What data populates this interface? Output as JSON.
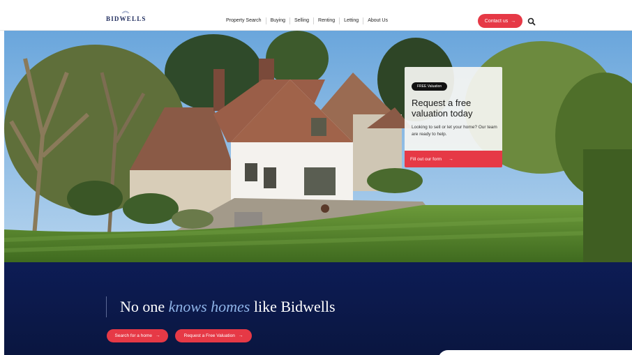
{
  "header": {
    "logo_text": "BIDWELLS",
    "nav": [
      "Property Search",
      "Buying",
      "Selling",
      "Renting",
      "Letting",
      "About Us"
    ],
    "contact_label": "Contact us",
    "arrow": "→"
  },
  "hero": {
    "card": {
      "badge": "FREE Valuation",
      "title": "Request a free valuation today",
      "text": "Looking to sell or let your home? Our team are ready to help.",
      "cta": "Fill out our form"
    },
    "slides": 3,
    "active_slide": 1
  },
  "band": {
    "headline_pre": "No one ",
    "headline_accent": "knows homes",
    "headline_post": " like Bidwells",
    "btn_search": "Search for a home",
    "btn_valuation": "Request a Free Valuation"
  },
  "colors": {
    "accent": "#e63946",
    "navy": "#0d1c55",
    "headline_accent": "#8fb4e8"
  },
  "icons": [
    "search-icon",
    "arrow-right-icon",
    "logo-mark-icon"
  ]
}
